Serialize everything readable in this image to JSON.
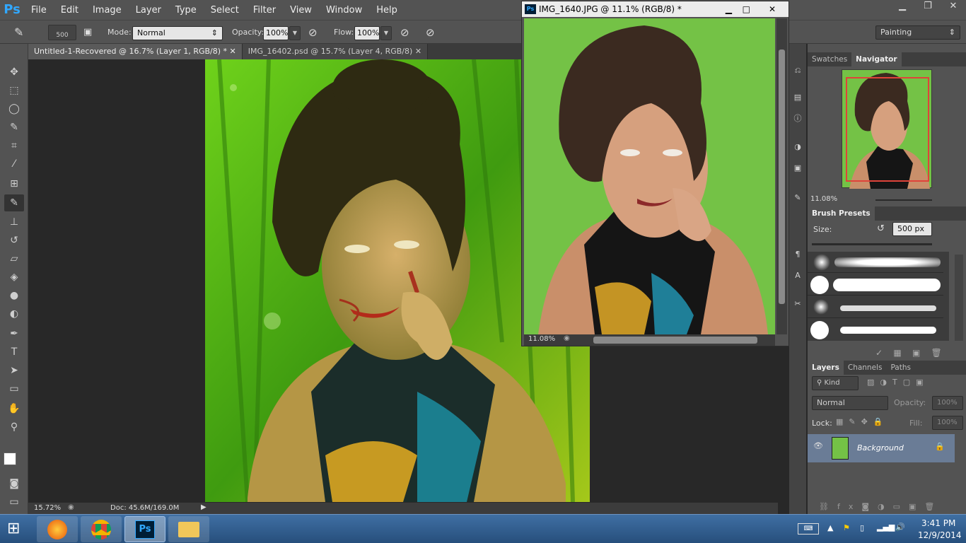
{
  "menubar": {
    "logo": "Ps",
    "items": [
      "File",
      "Edit",
      "Image",
      "Layer",
      "Type",
      "Select",
      "Filter",
      "View",
      "Window",
      "Help"
    ]
  },
  "options": {
    "brush_size": "500",
    "mode_label": "Mode:",
    "mode_value": "Normal",
    "opacity_label": "Opacity:",
    "opacity_value": "100%",
    "flow_label": "Flow:",
    "flow_value": "100%",
    "workspace": "Painting"
  },
  "tabs": [
    {
      "label": "Untitled-1-Recovered @ 16.7% (Layer 1, RGB/8) *"
    },
    {
      "label": "IMG_16402.psd @ 15.7% (Layer 4, RGB/8)"
    }
  ],
  "status": {
    "zoom": "15.72%",
    "doc": "Doc: 45.6M/169.0M"
  },
  "floating": {
    "title": "IMG_1640.JPG @ 11.1% (RGB/8) *",
    "zoom": "11.08%"
  },
  "navigator": {
    "tab_swatches": "Swatches",
    "tab_navigator": "Navigator",
    "zoom": "11.08%"
  },
  "brush_presets": {
    "title": "Brush Presets",
    "size_label": "Size:",
    "size_value": "500 px"
  },
  "layers": {
    "tab_layers": "Layers",
    "tab_channels": "Channels",
    "tab_paths": "Paths",
    "kind": "Kind",
    "blend": "Normal",
    "opacity_label": "Opacity:",
    "opacity_value": "100%",
    "lock_label": "Lock:",
    "fill_label": "Fill:",
    "fill_value": "100%",
    "layer_name": "Background"
  },
  "taskbar": {
    "time": "3:41 PM",
    "date": "12/9/2014"
  },
  "colors": {
    "accent": "#31a8ff",
    "panel": "#535353",
    "canvas": "#282828"
  }
}
